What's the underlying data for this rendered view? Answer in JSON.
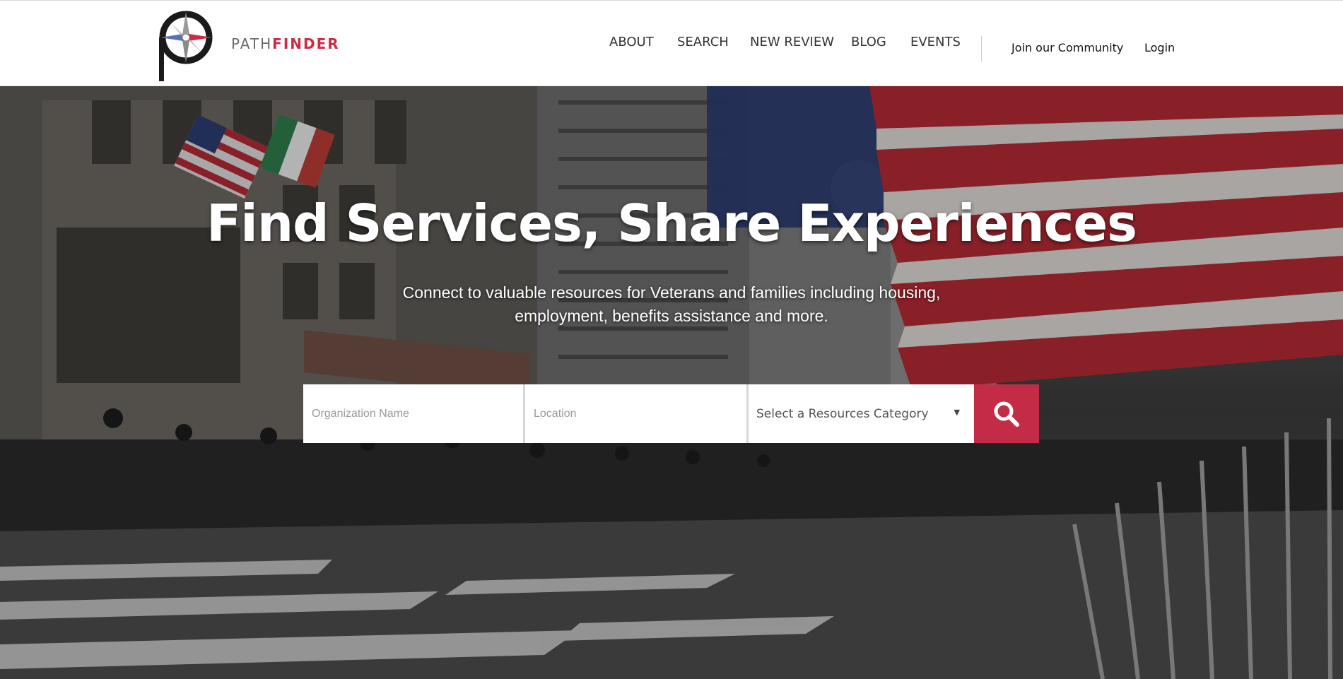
{
  "brand": {
    "name_part1": "PATH",
    "name_part2": "FINDER",
    "accent": "#cc2b45"
  },
  "nav": {
    "items": [
      {
        "label": "ABOUT"
      },
      {
        "label": "SEARCH"
      },
      {
        "label": "NEW REVIEW"
      },
      {
        "label": "BLOG"
      },
      {
        "label": "EVENTS"
      }
    ],
    "join_label": "Join our Community",
    "login_label": "Login"
  },
  "hero": {
    "title": "Find Services, Share Experiences",
    "subtitle": "Connect to valuable resources for Veterans and families including housing, employment, benefits assistance and more."
  },
  "search": {
    "org_placeholder": "Organization Name",
    "location_placeholder": "Location",
    "category_selected": "Select a Resources Category",
    "button_icon": "search-icon",
    "button_color": "#c42b47"
  }
}
